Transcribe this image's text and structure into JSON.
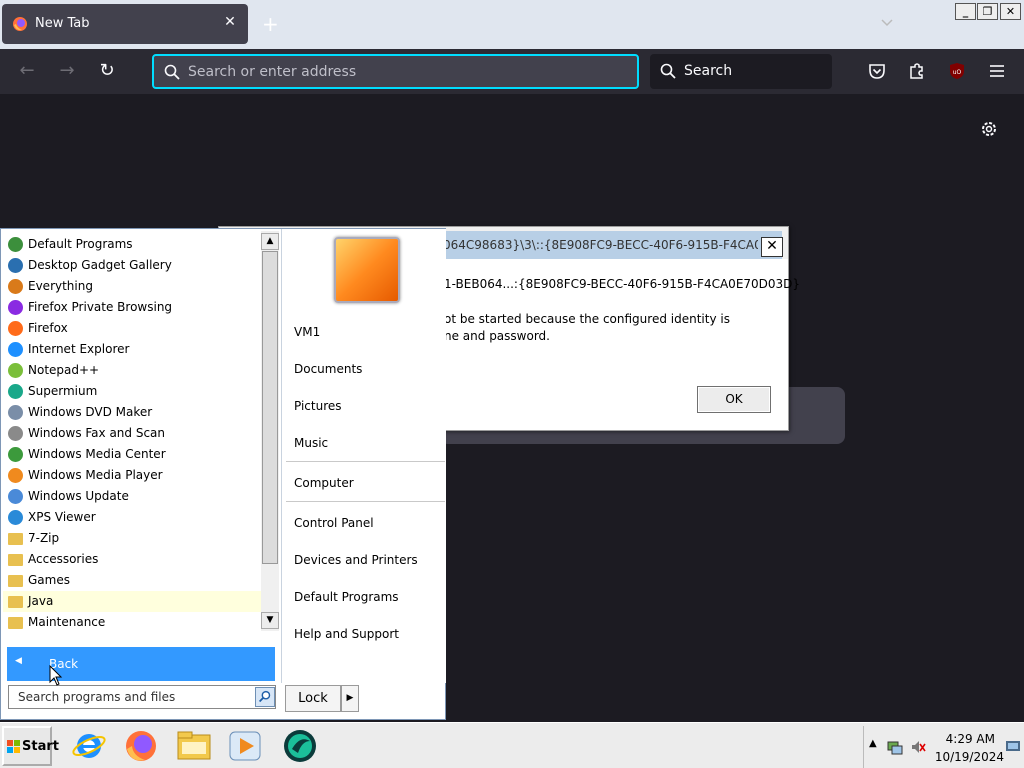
{
  "browser": {
    "tab_title": "New Tab",
    "tab_close": "✕",
    "new_tab_symbol": "+",
    "url_placeholder": "Search or enter address",
    "search_placeholder": "Search",
    "window_controls": {
      "minimize": "_",
      "restore": "❐",
      "close": "✕"
    },
    "nav": {
      "back": "←",
      "forward": "→",
      "reload": "↻"
    },
    "icons": [
      "firefox-icon",
      "search-icon",
      "pocket-icon",
      "extensions-icon",
      "ublock-icon",
      "menu-icon",
      "settings-icon"
    ],
    "accent_color": "#00ddff"
  },
  "dialog": {
    "title": "064C98683}\\3\\::{8E908FC9-BECC-40F6-915B-F4CA0E...",
    "close": "✕",
    "subtitle": "1-BEB064...:{8E908FC9-BECC-40F6-915B-F4CA0E70D03D}",
    "message_line1": "ot be started because the configured identity is",
    "message_line2": "ne and password.",
    "ok_label": "OK"
  },
  "start_menu": {
    "programs": [
      {
        "label": "Default Programs",
        "icon": "default-programs-icon",
        "color": "#3c8f3c"
      },
      {
        "label": "Desktop Gadget Gallery",
        "icon": "gadget-icon",
        "color": "#2a6fb0"
      },
      {
        "label": "Everything",
        "icon": "everything-icon",
        "color": "#d97a1a"
      },
      {
        "label": "Firefox Private Browsing",
        "icon": "private-browsing-icon",
        "color": "#8a2be2"
      },
      {
        "label": "Firefox",
        "icon": "firefox-icon",
        "color": "#ff6b1a"
      },
      {
        "label": "Internet Explorer",
        "icon": "ie-icon",
        "color": "#1e90ff"
      },
      {
        "label": "Notepad++",
        "icon": "notepadpp-icon",
        "color": "#7bbf3a"
      },
      {
        "label": "Supermium",
        "icon": "supermium-icon",
        "color": "#1aa88a"
      },
      {
        "label": "Windows DVD Maker",
        "icon": "dvd-maker-icon",
        "color": "#7a8ea8"
      },
      {
        "label": "Windows Fax and Scan",
        "icon": "fax-icon",
        "color": "#8a8a8a"
      },
      {
        "label": "Windows Media Center",
        "icon": "media-center-icon",
        "color": "#3c9a3c"
      },
      {
        "label": "Windows Media Player",
        "icon": "media-player-icon",
        "color": "#f08a1e"
      },
      {
        "label": "Windows Update",
        "icon": "windows-update-icon",
        "color": "#4a8ad8"
      },
      {
        "label": "XPS Viewer",
        "icon": "xps-viewer-icon",
        "color": "#2a8ad8"
      },
      {
        "label": "7-Zip",
        "icon": "folder-icon",
        "color": "#e8c050"
      },
      {
        "label": "Accessories",
        "icon": "folder-icon",
        "color": "#e8c050"
      },
      {
        "label": "Games",
        "icon": "folder-icon",
        "color": "#e8c050"
      },
      {
        "label": "Java",
        "icon": "folder-icon",
        "color": "#e8c050",
        "highlighted": true
      },
      {
        "label": "Maintenance",
        "icon": "folder-icon",
        "color": "#e8c050"
      }
    ],
    "back_label": "Back",
    "search_placeholder": "Search programs and files",
    "right_pane": {
      "user": "VM1",
      "documents": "Documents",
      "pictures": "Pictures",
      "music": "Music",
      "computer": "Computer",
      "control_panel": "Control Panel",
      "devices_printers": "Devices and Printers",
      "default_programs": "Default Programs",
      "help_support": "Help and Support"
    },
    "lock_label": "Lock",
    "lock_arrow": "▶"
  },
  "taskbar": {
    "start_label": "Start",
    "apps": [
      "internet-explorer-icon",
      "firefox-icon",
      "explorer-icon",
      "media-player-icon",
      "supermium-icon"
    ],
    "time": "4:29 AM",
    "date": "10/19/2024"
  }
}
